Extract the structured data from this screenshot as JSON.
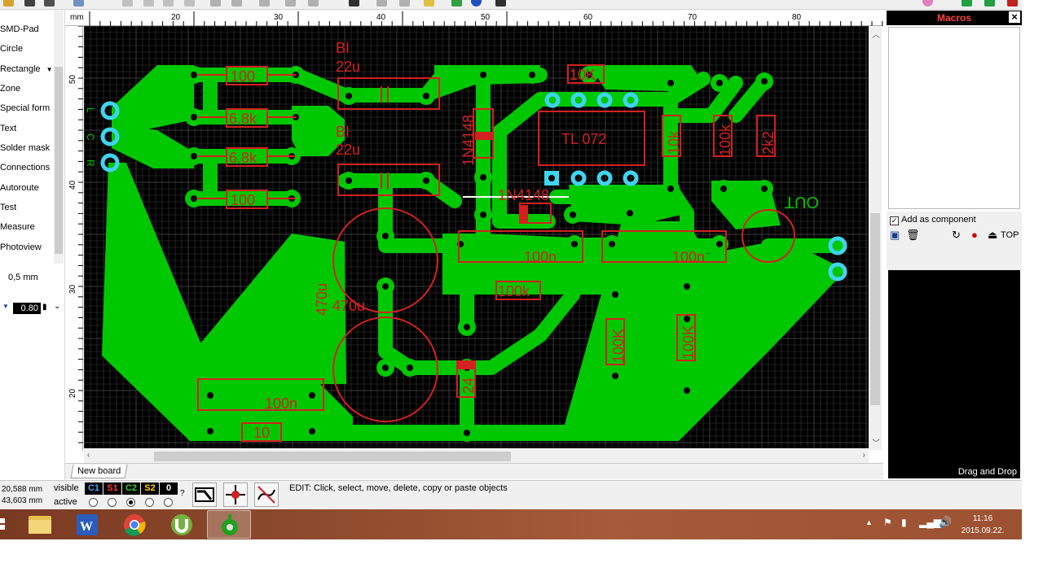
{
  "left_tools": {
    "items": [
      "SMD-Pad",
      "Circle",
      "Rectangle",
      "Zone",
      "Special form",
      "Text",
      "Solder mask",
      "Connections",
      "Autoroute",
      "Test",
      "Measure",
      "Photoview"
    ],
    "grid_size": "0,5 mm",
    "track_width": "0.80"
  },
  "ruler": {
    "unit": "mm",
    "top_labels": [
      "20",
      "30",
      "40",
      "50",
      "60",
      "70",
      "80"
    ],
    "left_labels": [
      "50",
      "40",
      "30",
      "20"
    ]
  },
  "board": {
    "labels": {
      "r_top1": "100",
      "r_top2": "6.8k",
      "r_top3": "6.8k",
      "r_top4": "100",
      "bi1": "BI",
      "bi1_val": "22u",
      "bi2": "BI",
      "bi2_val": "22u",
      "diode1": "1N4148",
      "diode2": "1N4148",
      "r_10k": "10K",
      "ic": "TL 072",
      "r_10k_v": "10k",
      "r_100k_v": "100k",
      "r_2k2": "2k2",
      "out": "OUT",
      "c_100n1": "100n",
      "c_100n2": "100n",
      "c_100n3": "100n",
      "r_100k_h": "100k",
      "cap1": "470u",
      "cap2": "470u",
      "r_100k_v2": "100K",
      "r_100k_v3": "100K",
      "r_10": "10",
      "r_24": "24",
      "in_l": "L",
      "in_c": "C",
      "in_r": "R",
      "out_pin": "+"
    }
  },
  "tabs": [
    "New board"
  ],
  "macros": {
    "title": "Macros",
    "add_as_component": "Add as component",
    "add_as_component_checked": true,
    "layer_label": "TOP",
    "drag_drop": "Drag and Drop"
  },
  "status": {
    "coord_x": "20,588 mm",
    "coord_y": "43,603 mm",
    "visible_label": "visible",
    "active_label": "active",
    "layers": [
      {
        "name": "C1",
        "color": "#4aa3ff"
      },
      {
        "name": "S1",
        "color": "#ff3b3b"
      },
      {
        "name": "C2",
        "color": "#32d23c"
      },
      {
        "name": "S2",
        "color": "#ffd400"
      },
      {
        "name": "0",
        "color": "#ffffff"
      }
    ],
    "active_index": 2,
    "question": "?",
    "edit_message": "EDIT:  Click, select, move, delete, copy or paste objects"
  },
  "taskbar": {
    "time": "11:16",
    "date": "2015.09.22."
  },
  "colors": {
    "copper": "#00c800",
    "silk": "#d42020",
    "pad": "#3fd4f0",
    "grid": "#3a3a3a",
    "board_bg": "#000000"
  }
}
